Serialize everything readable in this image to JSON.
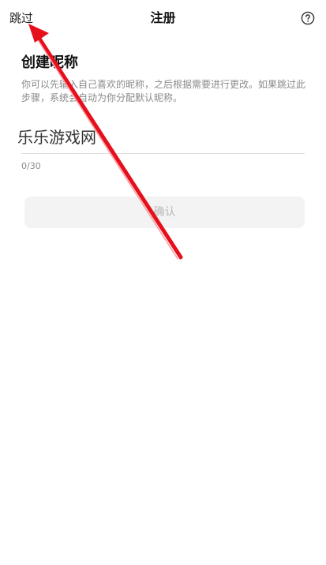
{
  "topbar": {
    "skip_label": "跳过",
    "title": "注册",
    "help_icon": "question-circle-icon"
  },
  "main": {
    "heading": "创建昵称",
    "description": "你可以先输入自己喜欢的昵称，之后根据需要进行更改。如果跳过此步骤，系统会自动为你分配默认昵称。",
    "nickname_input": {
      "value": "",
      "placeholder": ""
    },
    "counter": "0/30",
    "confirm_label": "确认"
  },
  "overlay": {
    "watermark": "乐乐游戏网",
    "arrow_icon": "red-arrow-icon",
    "arrow_color": "#e5101c"
  },
  "colors": {
    "disabled_button_bg": "#f3f3f3",
    "disabled_button_text": "#b8b8b8",
    "secondary_text": "#8a8a8a"
  }
}
